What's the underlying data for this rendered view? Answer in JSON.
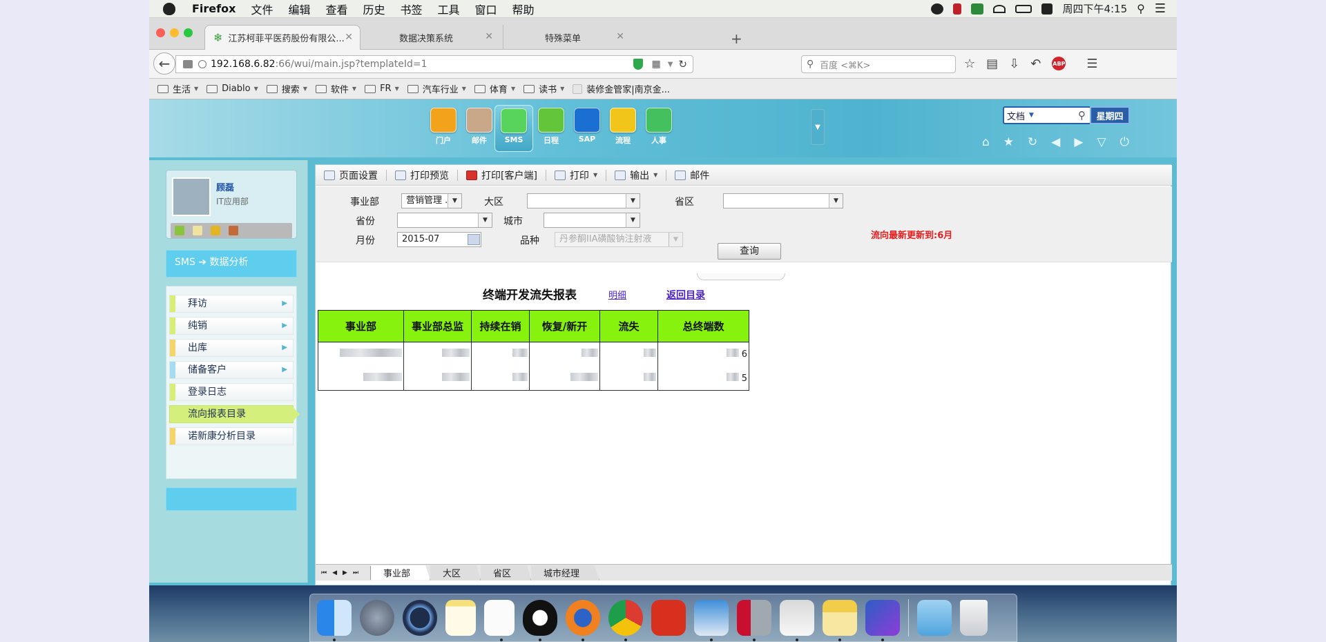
{
  "menubar": {
    "app": "Firefox",
    "items": [
      "文件",
      "编辑",
      "查看",
      "历史",
      "书签",
      "工具",
      "窗口",
      "帮助"
    ],
    "clock": "周四下午4:15"
  },
  "browser": {
    "tabs": [
      {
        "label": "江苏柯菲平医药股份有限公...",
        "active": true
      },
      {
        "label": "数据决策系统",
        "active": false
      },
      {
        "label": "特殊菜单",
        "active": false
      }
    ],
    "url_host": "192.168.6.82",
    "url_path": ":66/wui/main.jsp?templateId=1",
    "search_placeholder": "百度 <⌘K>",
    "bookmarks": [
      {
        "label": "生活",
        "menu": true
      },
      {
        "label": "Diablo",
        "menu": true
      },
      {
        "label": "搜索",
        "menu": true
      },
      {
        "label": "软件",
        "menu": true
      },
      {
        "label": "FR",
        "menu": true
      },
      {
        "label": "汽车行业",
        "menu": true
      },
      {
        "label": "体育",
        "menu": true
      },
      {
        "label": "读书",
        "menu": true
      },
      {
        "label": "装修金管家|南京金...",
        "menu": false
      }
    ]
  },
  "app": {
    "modules": [
      {
        "label": "门户",
        "color": "#f3a21b"
      },
      {
        "label": "邮件",
        "color": "#c9a88a"
      },
      {
        "label": "SMS",
        "color": "#58d35c",
        "active": true
      },
      {
        "label": "日程",
        "color": "#63c63a"
      },
      {
        "label": "SAP",
        "color": "#1b6fd2"
      },
      {
        "label": "流程",
        "color": "#f2c51b"
      },
      {
        "label": "人事",
        "color": "#44c05f"
      }
    ],
    "search_type": "文档",
    "weekday": "星期四"
  },
  "user": {
    "name": "顾磊",
    "dept": "IT应用部"
  },
  "sms_header": "SMS ➔ 数据分析",
  "nav": [
    {
      "label": "拜访",
      "stripe": "#d7ee77",
      "chevron": true
    },
    {
      "label": "纯销",
      "stripe": "#d7ee77",
      "chevron": true
    },
    {
      "label": "出库",
      "stripe": "#f5d46a",
      "chevron": true
    },
    {
      "label": "储备客户",
      "stripe": "#a6dcf0",
      "chevron": true
    },
    {
      "label": "登录日志",
      "stripe": "#d7ee77",
      "chevron": false
    },
    {
      "label": "流向报表目录",
      "stripe": "#d4ef7c",
      "chevron": false,
      "active": true
    },
    {
      "label": "诺新康分析目录",
      "stripe": "#f5d46a",
      "chevron": false
    }
  ],
  "toolbar": {
    "page_setup": "页面设置",
    "print_preview": "打印预览",
    "print_client": "打印[客户端]",
    "print": "打印",
    "export": "输出",
    "mail": "邮件"
  },
  "filters": {
    "division_label": "事业部",
    "division_value": "营销管理 ...",
    "region_label": "大区",
    "region_value": "",
    "province_area_label": "省区",
    "province_area_value": "",
    "province_label": "省份",
    "province_value": "",
    "city_label": "城市",
    "city_value": "",
    "month_label": "月份",
    "month_value": "2015-07",
    "product_label": "品种",
    "product_value": "丹参酮IIA磺酸钠注射液",
    "query_button": "查询",
    "update_note": "流向最新更新到:6月"
  },
  "report": {
    "title": "终端开发流失报表",
    "detail_link": "明细",
    "back_link": "返回目录",
    "columns": [
      "事业部",
      "事业部总监",
      "持续在销",
      "恢复/新开",
      "流失",
      "总终端数"
    ],
    "rows": [
      {
        "total": "6"
      },
      {
        "total": "5"
      }
    ]
  },
  "sheet_tabs": [
    "事业部",
    "大区",
    "省区",
    "城市经理"
  ]
}
